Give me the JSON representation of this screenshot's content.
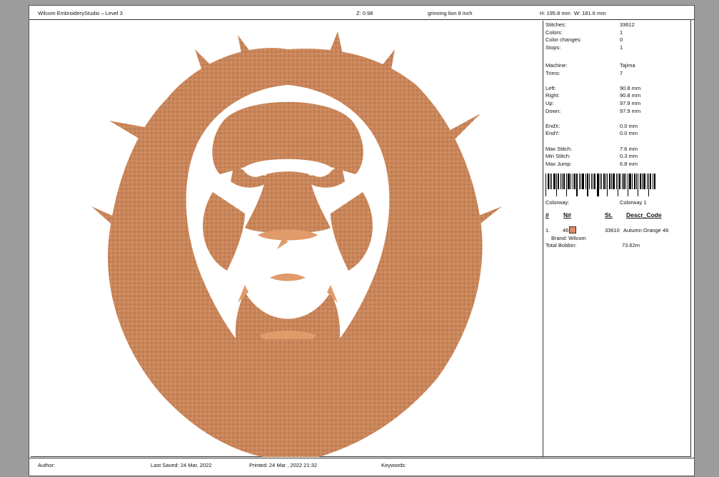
{
  "header": {
    "app_title": "Wilcom EmbroideryStudio – Level 3",
    "zoom": "Z: 0.98",
    "design_name": "grinning lion 8 inch",
    "height": "H: 195.8 mm",
    "width": "W: 181.6 mm"
  },
  "info": {
    "stitches_label": "Stitches:",
    "stitches": "33612",
    "colors_label": "Colors:",
    "colors": "1",
    "color_changes_label": "Color changes:",
    "color_changes": "0",
    "stops_label": "Stops:",
    "stops": "1",
    "machine_label": "Machine:",
    "machine": "Tajima",
    "trims_label": "Trims:",
    "trims": "7",
    "left_label": "Left:",
    "left": "90.8 mm",
    "right_label": "Right:",
    "right": "90.8 mm",
    "up_label": "Up:",
    "up": "97.9 mm",
    "down_label": "Down:",
    "down": "97.9 mm",
    "endx_label": "EndX:",
    "endx": "0.0 mm",
    "endy_label": "EndY:",
    "endy": "0.0 mm",
    "max_stitch_label": "Max Stitch:",
    "max_stitch": "7.6 mm",
    "min_stitch_label": "Min Stitch:",
    "min_stitch": "0.3 mm",
    "max_jump_label": "Max Jump:",
    "max_jump": "6.8 mm",
    "colorway_label": "Colorway:",
    "colorway": "Colorway 1"
  },
  "table": {
    "col_hash": "#",
    "col_n": "N#",
    "col_st": "St.",
    "col_desc": "Descr_Code",
    "row_index": "1.",
    "row_n": "46",
    "row_st": "33610",
    "row_desc": "Autumn Orange 46",
    "brand": "Brand: Wilcom",
    "total_bobbin_label": "Total Bobbin:",
    "total_bobbin": "73.62m",
    "swatch_color": "#e08c6a"
  },
  "footer": {
    "author": "Author:",
    "last_saved": "Last Saved: 24 Mar, 2022",
    "printed": "Printed: 24 Mar , 2022 21:32",
    "keywords": "Keywords:"
  },
  "design": {
    "thread_color": "#c9865a",
    "thread_highlight": "#e19a6a"
  }
}
